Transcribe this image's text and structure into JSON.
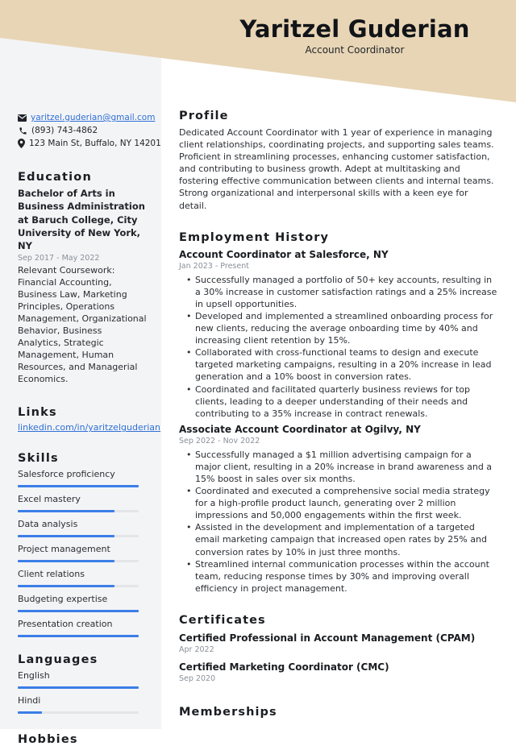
{
  "header": {
    "name": "Yaritzel Guderian",
    "title": "Account Coordinator",
    "accent_color": "#e8d5b5"
  },
  "contact": {
    "email": "yaritzel.guderian@gmail.com",
    "phone": "(893) 743-4862",
    "address": "123 Main St, Buffalo, NY 14201",
    "icons": [
      "envelope-icon",
      "phone-icon",
      "map-pin-icon"
    ]
  },
  "education": {
    "heading": "Education",
    "degree": "Bachelor of Arts in Business Administration at Baruch College, City University of New York, NY",
    "dates": "Sep 2017 - May 2022",
    "description": "Relevant Coursework: Financial Accounting, Business Law, Marketing Principles, Operations Management, Organizational Behavior, Business Analytics, Strategic Management, Human Resources, and Managerial Economics."
  },
  "links": {
    "heading": "Links",
    "items": [
      "linkedin.com/in/yaritzelguderian"
    ]
  },
  "skills": {
    "heading": "Skills",
    "bar_color": "#3b7ee8",
    "items": [
      {
        "label": "Salesforce proficiency",
        "level": 1.0
      },
      {
        "label": "Excel mastery",
        "level": 0.8
      },
      {
        "label": "Data analysis",
        "level": 0.8
      },
      {
        "label": "Project management",
        "level": 0.8
      },
      {
        "label": "Client relations",
        "level": 0.8
      },
      {
        "label": "Budgeting expertise",
        "level": 1.0
      },
      {
        "label": "Presentation creation",
        "level": 1.0
      }
    ]
  },
  "languages": {
    "heading": "Languages",
    "items": [
      {
        "label": "English",
        "level": 1.0
      },
      {
        "label": "Hindi",
        "level": 0.2
      }
    ]
  },
  "hobbies": {
    "heading": "Hobbies"
  },
  "profile": {
    "heading": "Profile",
    "text": "Dedicated Account Coordinator with 1 year of experience in managing client relationships, coordinating projects, and supporting sales teams. Proficient in streamlining processes, enhancing customer satisfaction, and contributing to business growth. Adept at multitasking and fostering effective communication between clients and internal teams. Strong organizational and interpersonal skills with a keen eye for detail."
  },
  "employment": {
    "heading": "Employment History",
    "jobs": [
      {
        "title": "Account Coordinator at Salesforce, NY",
        "dates": "Jan 2023 - Present",
        "bullets": [
          "Successfully managed a portfolio of 50+ key accounts, resulting in a 30% increase in customer satisfaction ratings and a 25% increase in upsell opportunities.",
          "Developed and implemented a streamlined onboarding process for new clients, reducing the average onboarding time by 40% and increasing client retention by 15%.",
          "Collaborated with cross-functional teams to design and execute targeted marketing campaigns, resulting in a 20% increase in lead generation and a 10% boost in conversion rates.",
          "Coordinated and facilitated quarterly business reviews for top clients, leading to a deeper understanding of their needs and contributing to a 35% increase in contract renewals."
        ]
      },
      {
        "title": "Associate Account Coordinator at Ogilvy, NY",
        "dates": "Sep 2022 - Nov 2022",
        "bullets": [
          "Successfully managed a $1 million advertising campaign for a major client, resulting in a 20% increase in brand awareness and a 15% boost in sales over six months.",
          "Coordinated and executed a comprehensive social media strategy for a high-profile product launch, generating over 2 million impressions and 50,000 engagements within the first week.",
          "Assisted in the development and implementation of a targeted email marketing campaign that increased open rates by 25% and conversion rates by 10% in just three months.",
          "Streamlined internal communication processes within the account team, reducing response times by 30% and improving overall efficiency in project management."
        ]
      }
    ]
  },
  "certificates": {
    "heading": "Certificates",
    "items": [
      {
        "title": "Certified Professional in Account Management (CPAM)",
        "date": "Apr 2022"
      },
      {
        "title": "Certified Marketing Coordinator (CMC)",
        "date": "Sep 2020"
      }
    ]
  },
  "memberships": {
    "heading": "Memberships"
  }
}
